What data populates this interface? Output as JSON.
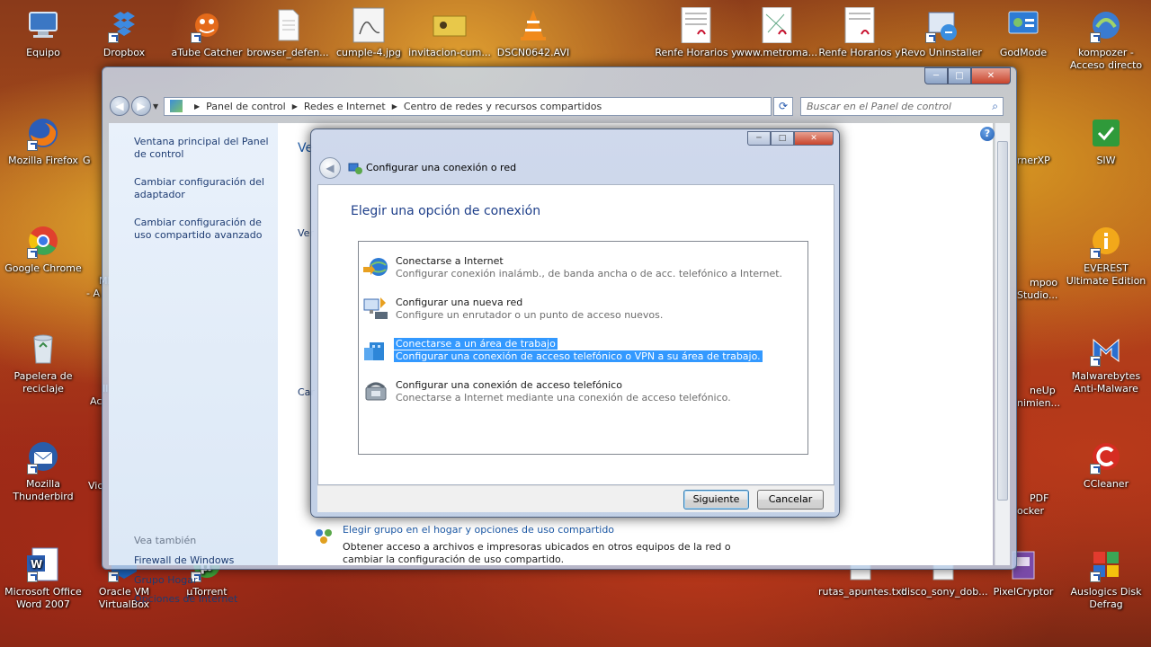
{
  "desktop": {
    "icons": [
      {
        "label": "Equipo",
        "icon": "computer-icon"
      },
      {
        "label": "Dropbox",
        "icon": "dropbox-icon"
      },
      {
        "label": "aTube Catcher",
        "icon": "atube-icon"
      },
      {
        "label": "browser_defen...",
        "icon": "file-icon"
      },
      {
        "label": "cumple-4.jpg",
        "icon": "image-icon"
      },
      {
        "label": "invitacion-cum...",
        "icon": "image-icon"
      },
      {
        "label": "DSCN0642.AVI",
        "icon": "vlc-icon"
      },
      {
        "label": "Renfe Horarios y",
        "icon": "pdf-icon"
      },
      {
        "label": "www.metroma...",
        "icon": "pdf-icon"
      },
      {
        "label": "Renfe Horarios y",
        "icon": "pdf-icon"
      },
      {
        "label": "Revo Uninstaller",
        "icon": "revo-icon"
      },
      {
        "label": "GodMode",
        "icon": "control-panel-icon"
      },
      {
        "label": "kompozer - Acceso directo",
        "icon": "kompozer-icon"
      },
      {
        "label": "Mozilla Firefox",
        "icon": "firefox-icon"
      },
      {
        "label": "Google Chrome",
        "icon": "chrome-icon"
      },
      {
        "label": "Papelera de reciclaje",
        "icon": "recycle-bin-icon"
      },
      {
        "label": "Mozilla Thunderbird",
        "icon": "thunderbird-icon"
      },
      {
        "label": "Microsoft Office Word 2007",
        "icon": "word-icon"
      },
      {
        "label": "Oracle VM VirtualBox",
        "icon": "virtualbox-icon"
      },
      {
        "label": "µTorrent",
        "icon": "utorrent-icon"
      },
      {
        "label": "rutas_apuntes.txt",
        "icon": "text-file-icon"
      },
      {
        "label": "disco_sony_dob...",
        "icon": "file-icon"
      },
      {
        "label": "PixelCryptor",
        "icon": "pixelcryptor-icon"
      },
      {
        "label": "Auslogics Disk Defrag",
        "icon": "defrag-icon"
      },
      {
        "label": "SIW",
        "icon": "siw-icon"
      },
      {
        "label": "EVEREST Ultimate Edition",
        "icon": "everest-icon"
      },
      {
        "label": "Malwarebytes Anti-Malware",
        "icon": "malwarebytes-icon"
      },
      {
        "label": "CCleaner",
        "icon": "ccleaner-icon"
      }
    ],
    "partial_labels": {
      "g": "G",
      "mi_a": "MI\n- A",
      "il_ac": "Il\nAc",
      "vic": "Vic",
      "rnerxp": "rnerXP",
      "mpoo": "mpoo\nStudio...",
      "neup": "neUp\nnimien...",
      "pdf_ocker": "PDF\nocker"
    }
  },
  "explorer": {
    "controls": {
      "min": "─",
      "max": "□",
      "close": "✕"
    },
    "breadcrumb": [
      "Panel de control",
      "Redes e Internet",
      "Centro de redes y recursos compartidos"
    ],
    "search_placeholder": "Buscar en el Panel de control",
    "sidebar": {
      "links": [
        "Ventana principal del Panel de control",
        "Cambiar configuración del adaptador",
        "Cambiar configuración de uso compartido avanzado"
      ],
      "see_also": "Vea también",
      "see_also_links": [
        "Firewall de Windows",
        "Grupo Hogar",
        "Opciones de Internet"
      ]
    },
    "content": {
      "heading_fragment": "Ve",
      "frag_ver": "Ver",
      "frag_car": "Car",
      "homegroup_link": "Elegir grupo en el hogar y opciones de uso compartido",
      "homegroup_desc": "Obtener acceso a archivos e impresoras ubicados en otros equipos de la red o cambiar la configuración de uso compartido."
    }
  },
  "dialog": {
    "title": "Configurar una conexión o red",
    "heading": "Elegir una opción de conexión",
    "selected_index": 2,
    "options": [
      {
        "title": "Conectarse a Internet",
        "desc": "Configurar conexión inalámb., de banda ancha o de acc. telefónico a Internet.",
        "icon": "globe-network-icon"
      },
      {
        "title": "Configurar una nueva red",
        "desc": "Configure un enrutador o un punto de acceso nuevos.",
        "icon": "new-network-icon"
      },
      {
        "title": "Conectarse a un área de trabajo",
        "desc": "Configurar una conexión de acceso telefónico o VPN a su área de trabajo.",
        "icon": "workplace-icon"
      },
      {
        "title": "Configurar una conexión de acceso telefónico",
        "desc": "Conectarse a Internet mediante una conexión de acceso telefónico.",
        "icon": "dialup-phone-icon"
      }
    ],
    "buttons": {
      "next": "Siguiente",
      "cancel": "Cancelar"
    },
    "accent_color": "#3399ff"
  }
}
